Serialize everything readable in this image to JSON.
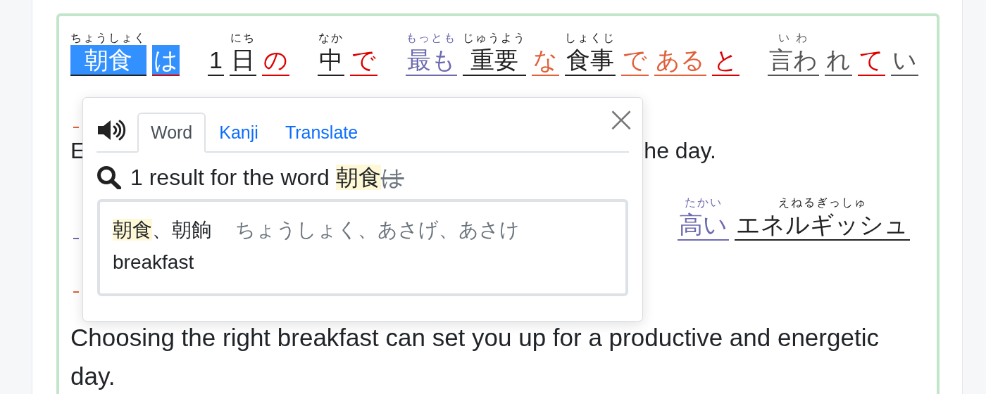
{
  "sentence_rows": [
    {
      "kind": "words",
      "groups": [
        [
          {
            "text": "朝食",
            "ruby": "ちょうしょく",
            "color": "#222222",
            "selected": true
          },
          {
            "text": "は",
            "color": "#dd0000",
            "selected": true
          }
        ],
        [
          {
            "text": "1",
            "color": "#222222",
            "selected": false
          },
          {
            "text": "日",
            "ruby": "にち",
            "color": "#222222",
            "selected": false
          },
          {
            "text": "の",
            "color": "#dd0000",
            "selected": false
          }
        ],
        [
          {
            "text": "中",
            "ruby": "なか",
            "color": "#222222",
            "selected": false
          },
          {
            "text": "で",
            "color": "#dd0000",
            "selected": false
          }
        ],
        [
          {
            "text": "最も",
            "ruby": "もっとも",
            "color": "#6c6aaf",
            "selected": false
          },
          {
            "text": "重要",
            "ruby": "じゅうよう",
            "color": "#222222",
            "selected": false
          },
          {
            "text": "な",
            "color": "#e0603a",
            "selected": false
          },
          {
            "text": "食事",
            "ruby": "しょくじ",
            "color": "#222222",
            "selected": false
          },
          {
            "text": "で",
            "color": "#e0603a",
            "selected": false
          },
          {
            "text": "ある",
            "color": "#e0603a",
            "selected": false
          },
          {
            "text": "と",
            "color": "#dd0000",
            "selected": false
          }
        ],
        [
          {
            "text": "言わ",
            "ruby": "い わ",
            "color": "#555555",
            "selected": false
          },
          {
            "text": "れ",
            "color": "#555555",
            "selected": false
          },
          {
            "text": "て",
            "color": "#dd0000",
            "selected": false
          },
          {
            "text": "い",
            "color": "#555555",
            "selected": false
          }
        ]
      ]
    },
    {
      "kind": "hidden",
      "color": "#e0603a"
    },
    {
      "kind": "english",
      "parts": [
        "E",
        "he day."
      ]
    },
    {
      "kind": "words",
      "color": "#6c6aaf",
      "groups": [
        [
          {
            "text": "高い",
            "ruby": "たかい",
            "color": "#6c6aaf",
            "selected": false
          },
          {
            "text": "エネルギッシュ",
            "ruby": "えねるぎっしゅ",
            "color": "#222222",
            "selected": false
          }
        ]
      ]
    },
    {
      "kind": "hidden",
      "color": "#e0603a"
    },
    {
      "kind": "translation",
      "text": "Choosing the right breakfast can set you up for a productive and energetic day."
    }
  ],
  "popup": {
    "tabs": [
      {
        "label": "Word",
        "selected": true
      },
      {
        "label": "Kanji",
        "selected": false
      },
      {
        "label": "Translate",
        "selected": false
      }
    ],
    "close": "×",
    "search": {
      "prefix": "1 result for the word ",
      "matched": "朝食",
      "unmatched": "は"
    },
    "results": [
      {
        "headword": "朝食",
        "variants": "、朝餉",
        "readings": "ちょうしょく、あさげ、あさけ",
        "meaning": "breakfast"
      }
    ]
  }
}
